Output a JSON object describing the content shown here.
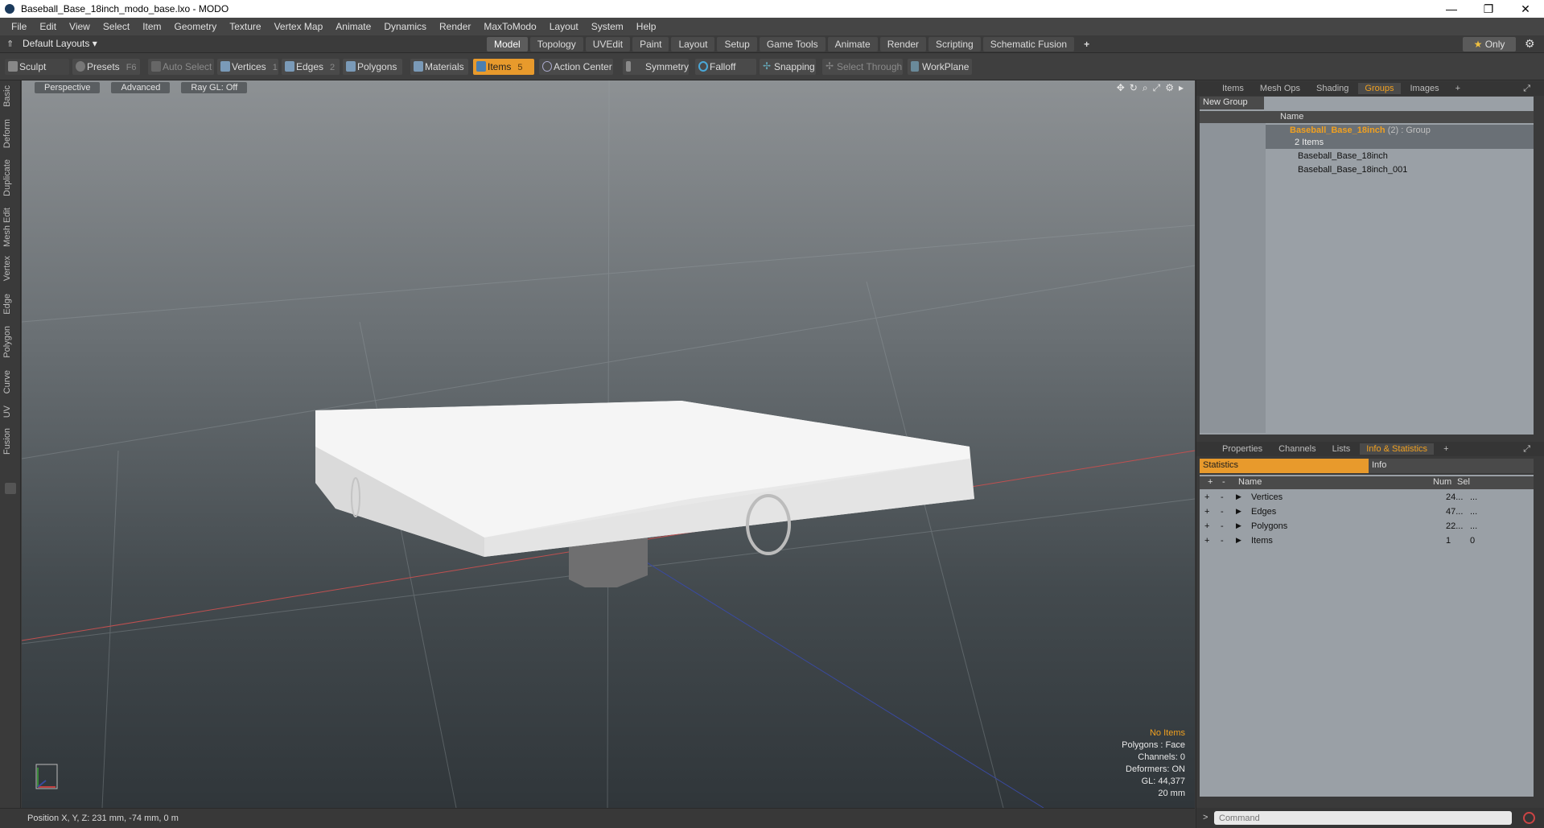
{
  "window": {
    "title": "Baseball_Base_18inch_modo_base.lxo - MODO",
    "controls": [
      "—",
      "❐",
      "✕"
    ]
  },
  "menu": [
    "File",
    "Edit",
    "View",
    "Select",
    "Item",
    "Geometry",
    "Texture",
    "Vertex Map",
    "Animate",
    "Dynamics",
    "Render",
    "MaxToModo",
    "Layout",
    "System",
    "Help"
  ],
  "layoutbar": {
    "layout_name": "Default Layouts ▾",
    "tabs": [
      "Model",
      "Topology",
      "UVEdit",
      "Paint",
      "Layout",
      "Setup",
      "Game Tools",
      "Animate",
      "Render",
      "Scripting",
      "Schematic Fusion"
    ],
    "active_tab": "Model",
    "only_label": "Only",
    "only_star": "★"
  },
  "toolbar": {
    "sculpt": "Sculpt",
    "presets": "Presets",
    "presets_key": "F6",
    "auto_select": "Auto Select",
    "vertices": "Vertices",
    "vertices_key": "1",
    "edges": "Edges",
    "edges_key": "2",
    "polygons": "Polygons",
    "materials": "Materials",
    "items": "Items",
    "items_key": "5",
    "action_center": "Action Center",
    "symmetry": "Symmetry",
    "falloff": "Falloff",
    "snapping": "Snapping",
    "select_through": "Select Through",
    "workplane": "WorkPlane"
  },
  "left_tabs": [
    "Basic",
    "Deform",
    "Duplicate",
    "Mesh Edit",
    "Vertex",
    "Edge",
    "Polygon",
    "Curve",
    "UV",
    "Fusion"
  ],
  "viewport": {
    "view_mode": "Perspective",
    "shading": "Advanced",
    "raygl": "Ray GL: Off",
    "info": {
      "selection": "No Items",
      "polygons": "Polygons : Face",
      "channels": "Channels: 0",
      "deformers": "Deformers: ON",
      "gl": "GL: 44,377",
      "scale": "20 mm"
    }
  },
  "status": {
    "position": "Position X, Y, Z:  231 mm, -74 mm, 0 m"
  },
  "groups_panel": {
    "tabs": [
      "Items",
      "Mesh Ops",
      "Shading",
      "Groups",
      "Images",
      "+"
    ],
    "active_tab": "Groups",
    "new_group": "New Group",
    "col_name": "Name",
    "group_name": "Baseball_Base_18inch",
    "group_suffix": "(2) : Group",
    "group_count": "2 Items",
    "children": [
      "Baseball_Base_18inch",
      "Baseball_Base_18inch_001"
    ]
  },
  "stats_panel": {
    "tabs": [
      "Properties",
      "Channels",
      "Lists",
      "Info & Statistics",
      "+"
    ],
    "active_tab": "Info & Statistics",
    "sub_tab_active": "Statistics",
    "sub_tab_other": "Info",
    "col_name": "Name",
    "col_num": "Num",
    "col_sel": "Sel",
    "rows": [
      {
        "name": "Vertices",
        "num": "24...",
        "sel": "..."
      },
      {
        "name": "Edges",
        "num": "47...",
        "sel": "..."
      },
      {
        "name": "Polygons",
        "num": "22...",
        "sel": "..."
      },
      {
        "name": "Items",
        "num": "1",
        "sel": "0"
      }
    ]
  },
  "command": {
    "prompt": ">",
    "placeholder": "Command"
  },
  "colors": {
    "accent": "#e89a2c",
    "group_highlight": "#f0a020"
  }
}
